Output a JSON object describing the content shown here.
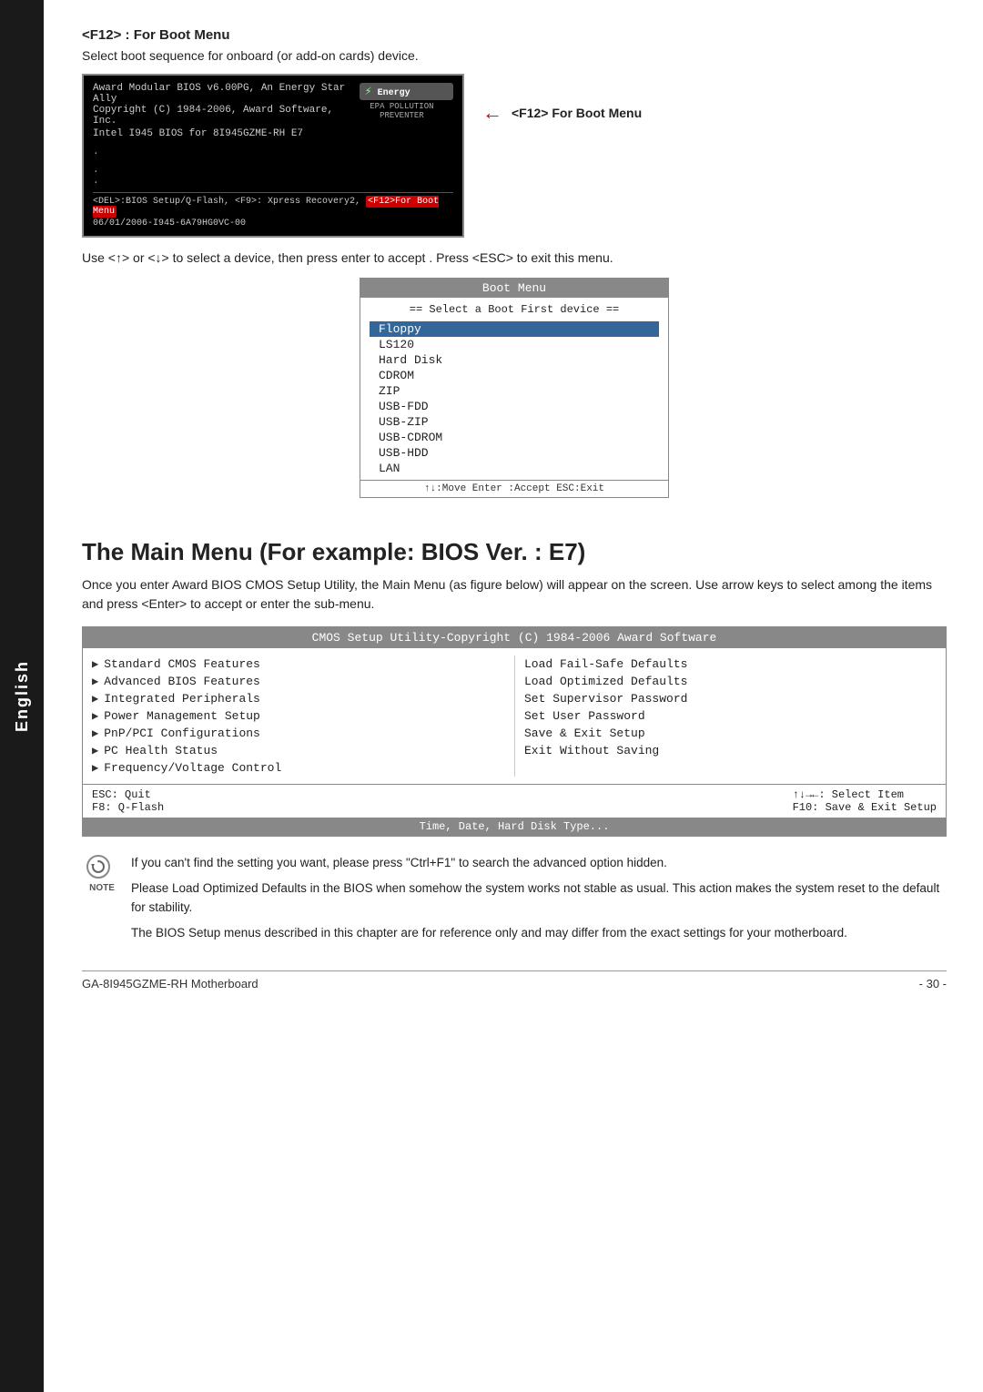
{
  "sidebar": {
    "label": "English"
  },
  "f12_section": {
    "heading": "<F12> : For Boot Menu",
    "desc": "Select boot sequence for onboard (or add-on cards) device.",
    "bios_screen": {
      "line1": "Award Modular BIOS v6.00PG, An Energy Star Ally",
      "line2": "Copyright (C) 1984-2006, Award Software, Inc.",
      "line3": "Intel I945 BIOS for 8I945GZME-RH E7",
      "logo_text": "Energy",
      "dots": ". . .",
      "bottom_text": "<DEL>:BIOS Setup/Q-Flash, <F9>: Xpress Recovery2, ",
      "f12_highlight": "<F12>For Boot Menu",
      "version_line": "06/01/2006-I945-6A79HG0VC-00"
    },
    "f12_label": "<F12> For Boot Menu",
    "use_line": "Use <↑> or <↓> to select a device, then press enter to accept . Press <ESC> to exit this menu."
  },
  "boot_menu": {
    "title": "Boot Menu",
    "subtitle": "==  Select a Boot First device  ==",
    "items": [
      {
        "label": "Floppy",
        "selected": true
      },
      {
        "label": "LS120",
        "selected": false
      },
      {
        "label": "Hard Disk",
        "selected": false
      },
      {
        "label": "CDROM",
        "selected": false
      },
      {
        "label": "ZIP",
        "selected": false
      },
      {
        "label": "USB-FDD",
        "selected": false
      },
      {
        "label": "USB-ZIP",
        "selected": false
      },
      {
        "label": "USB-CDROM",
        "selected": false
      },
      {
        "label": "USB-HDD",
        "selected": false
      },
      {
        "label": "LAN",
        "selected": false
      }
    ],
    "footer": "↑↓:Move   Enter :Accept   ESC:Exit"
  },
  "main_menu_section": {
    "heading": "The Main Menu (For example: BIOS Ver. : E7)",
    "desc1": "Once you enter Award BIOS CMOS Setup Utility, the Main Menu (as figure below) will appear on the screen.  Use arrow keys to select among the items and press <Enter> to accept or enter the sub-menu."
  },
  "cmos_box": {
    "title": "CMOS Setup Utility-Copyright (C) 1984-2006 Award Software",
    "left_items": [
      "Standard CMOS Features",
      "Advanced BIOS Features",
      "Integrated Peripherals",
      "Power Management Setup",
      "PnP/PCI Configurations",
      "PC Health Status",
      "Frequency/Voltage Control"
    ],
    "right_items": [
      "Load Fail-Safe Defaults",
      "Load Optimized Defaults",
      "Set Supervisor Password",
      "Set User Password",
      "Save & Exit Setup",
      "Exit Without Saving"
    ],
    "footer_left1": "ESC: Quit",
    "footer_right1": "↑↓→←: Select Item",
    "footer_left2": "F8: Q-Flash",
    "footer_right2": "F10: Save & Exit Setup",
    "status_bar": "Time, Date, Hard Disk Type..."
  },
  "note": {
    "icon_label": "NOTE",
    "text1": "If you can't find the setting you want, please press \"Ctrl+F1\" to search the advanced option hidden.",
    "text2": "Please Load Optimized Defaults in the BIOS when somehow the system works not stable as usual. This action makes the system reset to the default for stability.",
    "text3": "The BIOS Setup menus described in this chapter are for reference only and may differ from the exact settings for your motherboard."
  },
  "footer": {
    "left": "GA-8I945GZME-RH Motherboard",
    "right": "- 30 -"
  }
}
